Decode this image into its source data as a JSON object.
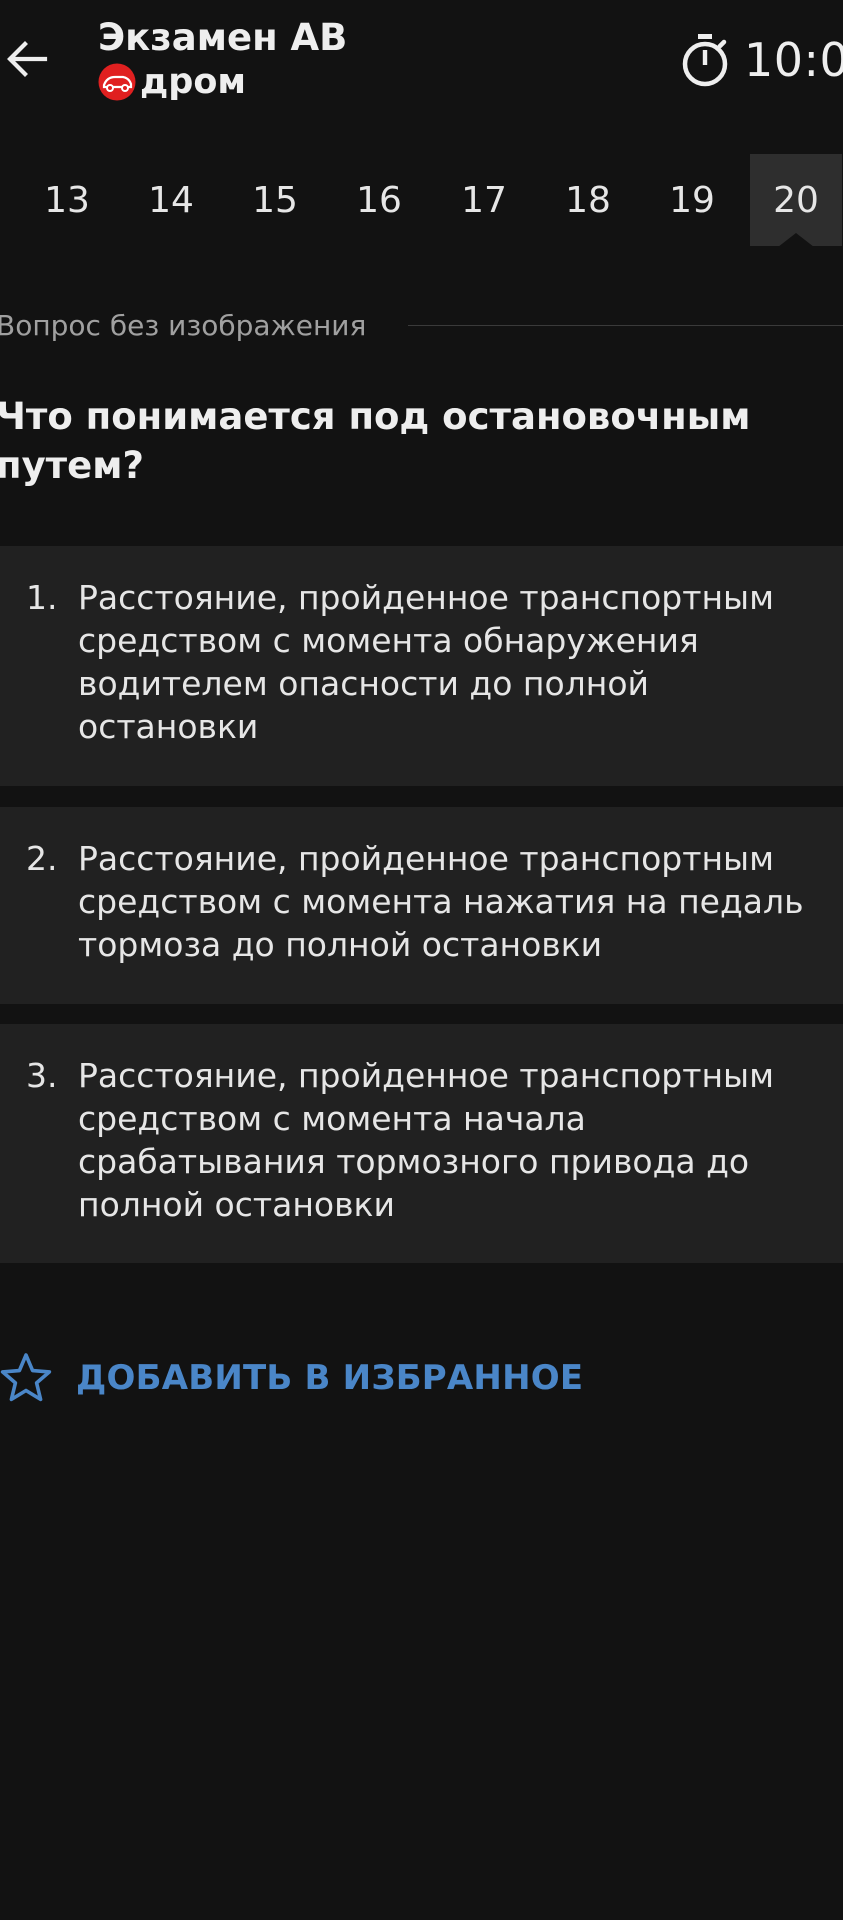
{
  "header": {
    "title": "Экзамен AB",
    "brand_name": "дром",
    "timer": "10:0",
    "back_icon": "arrow-left-icon",
    "timer_icon": "stopwatch-icon",
    "brand_icon": "drom-logo-icon"
  },
  "questions": {
    "tabs": [
      "13",
      "14",
      "15",
      "16",
      "17",
      "18",
      "19",
      "20"
    ],
    "active": "20"
  },
  "question": {
    "section_label": "Вопрос без изображения",
    "text": "Что понимается под остановочным путем?"
  },
  "answers": [
    {
      "number": "1.",
      "text": "Расстояние, пройденное транспортным средством с момента обнаружения водителем опасности до полной остановки"
    },
    {
      "number": "2.",
      "text": "Расстояние, пройденное транспортным средством с момента нажатия на педаль тормоза до полной остановки"
    },
    {
      "number": "3.",
      "text": "Расстояние, пройденное транспортным средством с момента начала срабатывания тормозного привода до полной остановки"
    }
  ],
  "favorite": {
    "label": "ДОБАВИТЬ В ИЗБРАННОЕ",
    "icon": "star-outline-icon"
  },
  "colors": {
    "background": "#121212",
    "card": "#212121",
    "active_tab": "#2e2e2e",
    "accent": "#4a86c8",
    "brand_red": "#e02020"
  }
}
